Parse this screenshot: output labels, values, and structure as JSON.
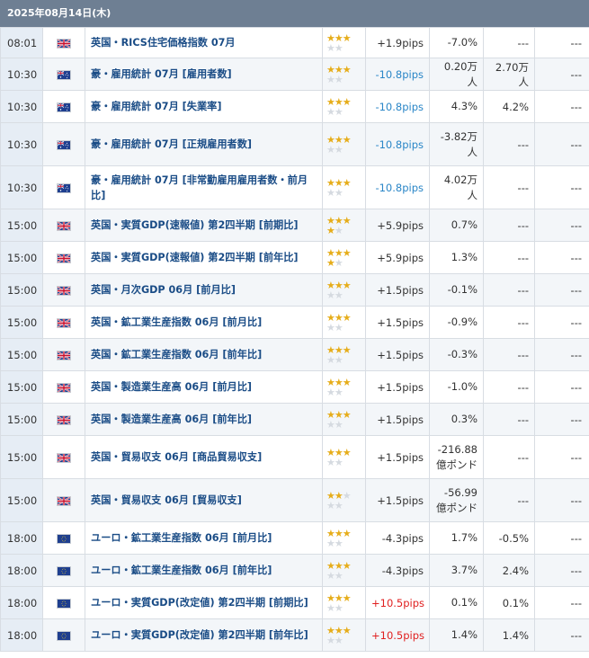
{
  "header": {
    "title": "2025年08月14日(木)"
  },
  "rows": [
    {
      "time": "08:01",
      "flag": "uk",
      "event": "英国・RICS住宅価格指数 07月",
      "stars": [
        3,
        0
      ],
      "pips": "+1.9pips",
      "pips_class": "pos",
      "prev": "-7.0%",
      "forecast": "---",
      "actual": "---"
    },
    {
      "time": "10:30",
      "flag": "au",
      "event": "豪・雇用統計 07月 [雇用者数]",
      "stars": [
        3,
        0
      ],
      "pips": "-10.8pips",
      "pips_class": "neg",
      "prev": "0.20万人",
      "forecast": "2.70万人",
      "actual": "---"
    },
    {
      "time": "10:30",
      "flag": "au",
      "event": "豪・雇用統計 07月 [失業率]",
      "stars": [
        3,
        0
      ],
      "pips": "-10.8pips",
      "pips_class": "neg",
      "prev": "4.3%",
      "forecast": "4.2%",
      "actual": "---"
    },
    {
      "time": "10:30",
      "flag": "au",
      "event": "豪・雇用統計 07月 [正規雇用者数]",
      "stars": [
        3,
        0
      ],
      "pips": "-10.8pips",
      "pips_class": "neg",
      "prev": "-3.82万人",
      "forecast": "---",
      "actual": "---"
    },
    {
      "time": "10:30",
      "flag": "au",
      "event": "豪・雇用統計 07月 [非常勤雇用雇用者数・前月比]",
      "stars": [
        3,
        0
      ],
      "pips": "-10.8pips",
      "pips_class": "neg",
      "prev": "4.02万人",
      "forecast": "---",
      "actual": "---"
    },
    {
      "time": "15:00",
      "flag": "uk",
      "event": "英国・実質GDP(速報値) 第2四半期 [前期比]",
      "stars": [
        3,
        1
      ],
      "pips": "+5.9pips",
      "pips_class": "pos",
      "prev": "0.7%",
      "forecast": "---",
      "actual": "---"
    },
    {
      "time": "15:00",
      "flag": "uk",
      "event": "英国・実質GDP(速報値) 第2四半期 [前年比]",
      "stars": [
        3,
        1
      ],
      "pips": "+5.9pips",
      "pips_class": "pos",
      "prev": "1.3%",
      "forecast": "---",
      "actual": "---"
    },
    {
      "time": "15:00",
      "flag": "uk",
      "event": "英国・月次GDP 06月 [前月比]",
      "stars": [
        3,
        0
      ],
      "pips": "+1.5pips",
      "pips_class": "pos",
      "prev": "-0.1%",
      "forecast": "---",
      "actual": "---"
    },
    {
      "time": "15:00",
      "flag": "uk",
      "event": "英国・鉱工業生産指数 06月 [前月比]",
      "stars": [
        3,
        0
      ],
      "pips": "+1.5pips",
      "pips_class": "pos",
      "prev": "-0.9%",
      "forecast": "---",
      "actual": "---"
    },
    {
      "time": "15:00",
      "flag": "uk",
      "event": "英国・鉱工業生産指数 06月 [前年比]",
      "stars": [
        3,
        0
      ],
      "pips": "+1.5pips",
      "pips_class": "pos",
      "prev": "-0.3%",
      "forecast": "---",
      "actual": "---"
    },
    {
      "time": "15:00",
      "flag": "uk",
      "event": "英国・製造業生産高 06月 [前月比]",
      "stars": [
        3,
        0
      ],
      "pips": "+1.5pips",
      "pips_class": "pos",
      "prev": "-1.0%",
      "forecast": "---",
      "actual": "---"
    },
    {
      "time": "15:00",
      "flag": "uk",
      "event": "英国・製造業生産高 06月 [前年比]",
      "stars": [
        3,
        0
      ],
      "pips": "+1.5pips",
      "pips_class": "pos",
      "prev": "0.3%",
      "forecast": "---",
      "actual": "---"
    },
    {
      "time": "15:00",
      "flag": "uk",
      "event": "英国・貿易収支 06月 [商品貿易収支]",
      "stars": [
        3,
        0
      ],
      "pips": "+1.5pips",
      "pips_class": "pos",
      "prev": "-216.88億ポンド",
      "forecast": "---",
      "actual": "---"
    },
    {
      "time": "15:00",
      "flag": "uk",
      "event": "英国・貿易収支 06月 [貿易収支]",
      "stars": [
        2,
        0
      ],
      "pips": "+1.5pips",
      "pips_class": "pos",
      "prev": "-56.99億ポンド",
      "forecast": "---",
      "actual": "---"
    },
    {
      "time": "18:00",
      "flag": "eu",
      "event": "ユーロ・鉱工業生産指数 06月 [前月比]",
      "stars": [
        3,
        0
      ],
      "pips": "-4.3pips",
      "pips_class": "pos",
      "prev": "1.7%",
      "forecast": "-0.5%",
      "actual": "---"
    },
    {
      "time": "18:00",
      "flag": "eu",
      "event": "ユーロ・鉱工業生産指数 06月 [前年比]",
      "stars": [
        3,
        0
      ],
      "pips": "-4.3pips",
      "pips_class": "pos",
      "prev": "3.7%",
      "forecast": "2.4%",
      "actual": "---"
    },
    {
      "time": "18:00",
      "flag": "eu",
      "event": "ユーロ・実質GDP(改定値) 第2四半期 [前期比]",
      "stars": [
        3,
        0
      ],
      "pips": "+10.5pips",
      "pips_class": "red",
      "prev": "0.1%",
      "forecast": "0.1%",
      "actual": "---"
    },
    {
      "time": "18:00",
      "flag": "eu",
      "event": "ユーロ・実質GDP(改定値) 第2四半期 [前年比]",
      "stars": [
        3,
        0
      ],
      "pips": "+10.5pips",
      "pips_class": "red",
      "prev": "1.4%",
      "forecast": "1.4%",
      "actual": "---"
    }
  ]
}
